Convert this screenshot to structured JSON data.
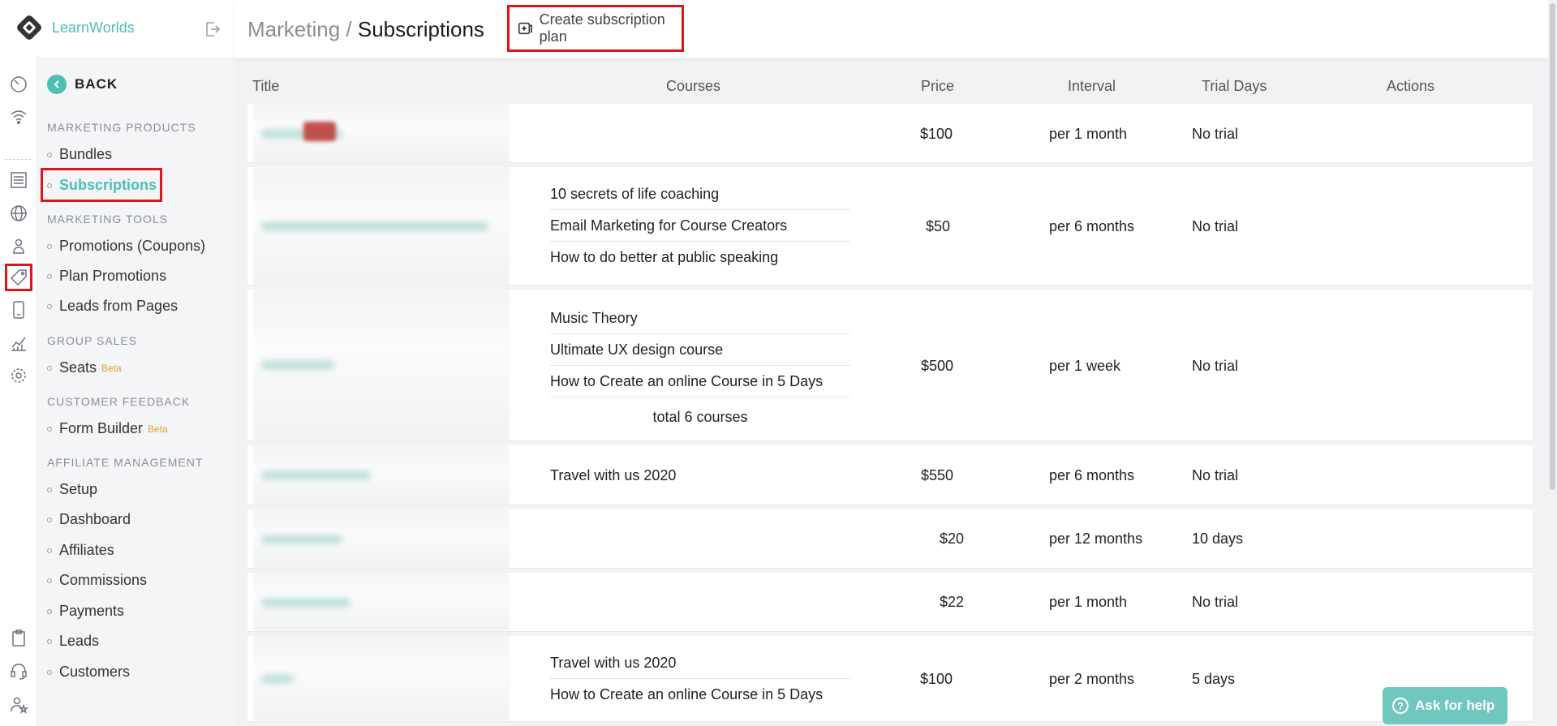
{
  "sidebar": {
    "brand": "LearnWorlds",
    "back_label": "BACK",
    "sections": [
      {
        "title": "MARKETING PRODUCTS",
        "items": [
          {
            "label": "Bundles"
          },
          {
            "label": "Subscriptions"
          }
        ]
      },
      {
        "title": "MARKETING TOOLS",
        "items": [
          {
            "label": "Promotions (Coupons)"
          },
          {
            "label": "Plan Promotions"
          },
          {
            "label": "Leads from Pages"
          }
        ]
      },
      {
        "title": "GROUP SALES",
        "items": [
          {
            "label": "Seats",
            "badge": "Beta"
          }
        ]
      },
      {
        "title": "CUSTOMER FEEDBACK",
        "items": [
          {
            "label": "Form Builder",
            "badge": "Beta"
          }
        ]
      },
      {
        "title": "AFFILIATE MANAGEMENT",
        "items": [
          {
            "label": "Setup"
          },
          {
            "label": "Dashboard"
          },
          {
            "label": "Affiliates"
          },
          {
            "label": "Commissions"
          },
          {
            "label": "Payments"
          },
          {
            "label": "Leads"
          },
          {
            "label": "Customers"
          }
        ]
      }
    ]
  },
  "rail_icons": [
    "dashboard-gauge-icon",
    "wifi-icon",
    "pages-list-icon",
    "globe-icon",
    "users-icon",
    "price-tag-icon",
    "mobile-device-icon",
    "analytics-chart-icon",
    "settings-gear-icon",
    "clipboard-icon",
    "headset-support-icon",
    "user-star-icon"
  ],
  "header": {
    "crumb_parent": "Marketing",
    "crumb_sep": "/",
    "crumb_current": "Subscriptions",
    "create_label": "Create subscription plan"
  },
  "table": {
    "columns": [
      "Title",
      "Courses",
      "Price",
      "Interval",
      "Trial Days",
      "Actions"
    ],
    "rows": [
      {
        "courses": [],
        "price": "$100",
        "interval": "per 1 month",
        "trial": "No trial"
      },
      {
        "courses": [
          "10 secrets of life coaching",
          "Email Marketing for Course Creators",
          "How to do better at public speaking"
        ],
        "price": "$50",
        "interval": "per 6 months",
        "trial": "No trial"
      },
      {
        "courses": [
          "Music Theory",
          "Ultimate UX design course",
          "How to Create an online Course in 5 Days"
        ],
        "total": "total 6 courses",
        "price": "$500",
        "interval": "per 1 week",
        "trial": "No trial"
      },
      {
        "courses": [
          "Travel with us 2020"
        ],
        "price": "$550",
        "interval": "per 6 months",
        "trial": "No trial"
      },
      {
        "courses": [],
        "price": "$20",
        "interval": "per 12 months",
        "trial": "10 days"
      },
      {
        "courses": [],
        "price": "$22",
        "interval": "per 1 month",
        "trial": "No trial"
      },
      {
        "courses": [
          "Travel with us 2020",
          "How to Create an online Course in 5 Days"
        ],
        "price": "$100",
        "interval": "per 2 months",
        "trial": "5 days"
      }
    ]
  },
  "help": {
    "label": "Ask for help",
    "icon_glyph": "?"
  },
  "colors": {
    "accent": "#4dbfb4",
    "highlight": "#e0141d",
    "beta": "#e0a030"
  }
}
